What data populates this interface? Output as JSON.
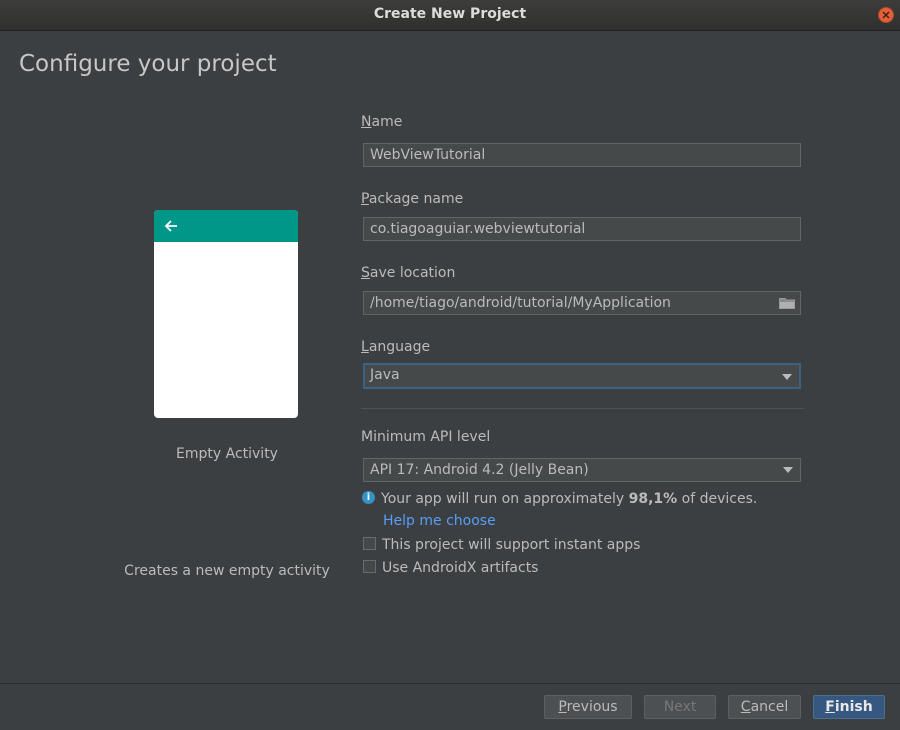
{
  "window": {
    "title": "Create New Project"
  },
  "heading": "Configure your project",
  "preview": {
    "activity_name": "Empty Activity",
    "description": "Creates a new empty activity",
    "accent_color": "#009688",
    "back_icon": "arrow-left-icon"
  },
  "form": {
    "name": {
      "mnemonic": "N",
      "label_rest": "ame",
      "value": "WebViewTutorial"
    },
    "package": {
      "mnemonic": "P",
      "label_rest": "ackage name",
      "value": "co.tiagoaguiar.webviewtutorial"
    },
    "save_location": {
      "mnemonic": "S",
      "label_rest": "ave location",
      "value": "/home/tiago/android/tutorial/MyApplication",
      "icon": "folder-icon"
    },
    "language": {
      "mnemonic": "L",
      "label_rest": "anguage",
      "value": "Java"
    },
    "min_api": {
      "label": "Minimum API level",
      "value": "API 17: Android 4.2 (Jelly Bean)"
    },
    "info": {
      "before": "Your app will run on approximately ",
      "percent": "98,1%",
      "after": " of devices."
    },
    "help_link": "Help me choose",
    "instant_apps": {
      "label": "This project will support instant apps",
      "checked": false
    },
    "androidx": {
      "label": "Use AndroidX artifacts",
      "checked": false
    }
  },
  "buttons": {
    "previous": {
      "mnemonic": "P",
      "rest": "revious"
    },
    "next": {
      "label": "Next"
    },
    "cancel": {
      "mnemonic": "C",
      "rest": "ancel"
    },
    "finish": {
      "mnemonic": "F",
      "rest": "inish"
    }
  }
}
